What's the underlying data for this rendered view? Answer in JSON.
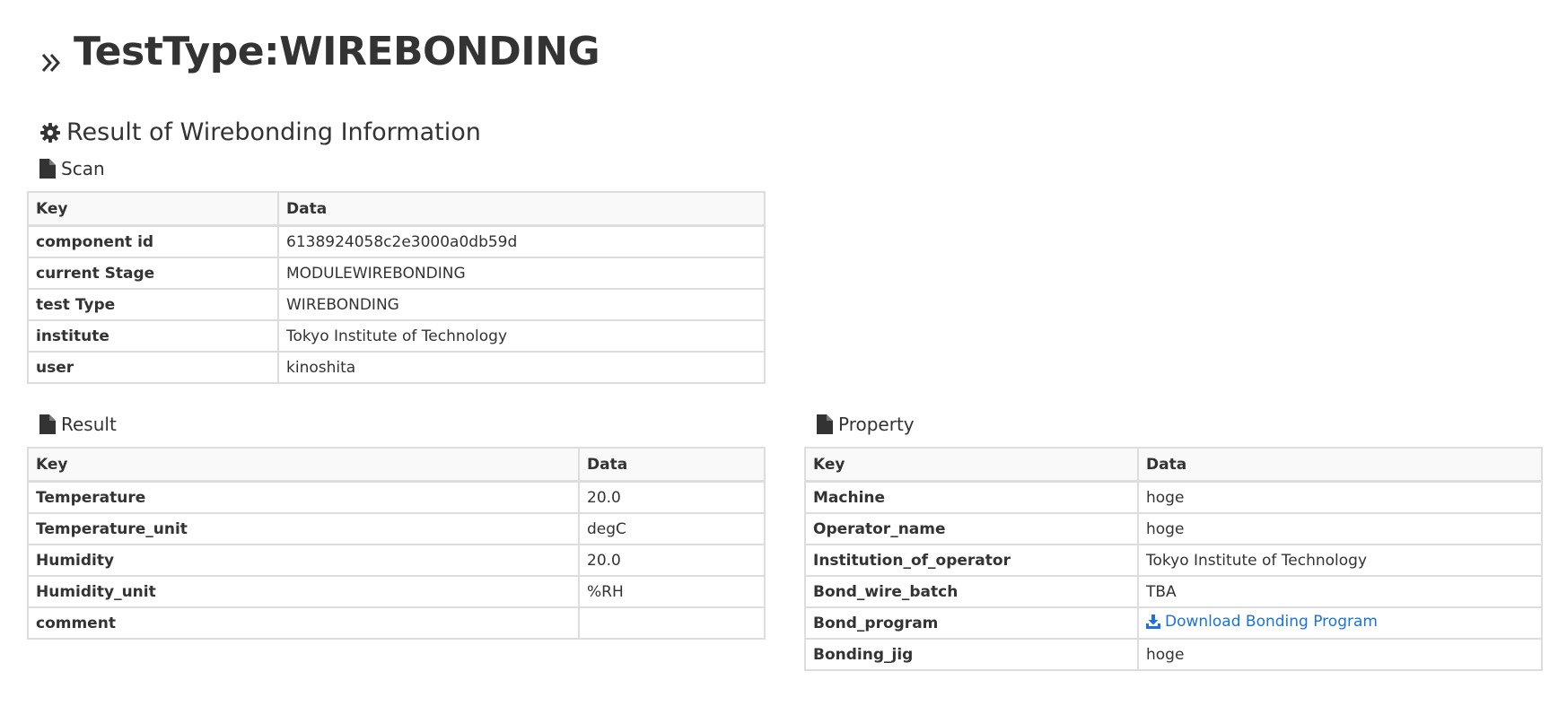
{
  "page_title": "TestType:WIREBONDING",
  "section_title": "Result of Wirebonding Information",
  "scan": {
    "title": "Scan",
    "headers": [
      "Key",
      "Data"
    ],
    "rows": [
      {
        "key": "component id",
        "value": "6138924058c2e3000a0db59d"
      },
      {
        "key": "current Stage",
        "value": "MODULEWIREBONDING"
      },
      {
        "key": "test Type",
        "value": "WIREBONDING"
      },
      {
        "key": "institute",
        "value": "Tokyo Institute of Technology"
      },
      {
        "key": "user",
        "value": "kinoshita"
      }
    ]
  },
  "result": {
    "title": "Result",
    "headers": [
      "Key",
      "Data"
    ],
    "rows": [
      {
        "key": "Temperature",
        "value": "20.0"
      },
      {
        "key": "Temperature_unit",
        "value": "degC"
      },
      {
        "key": "Humidity",
        "value": "20.0"
      },
      {
        "key": "Humidity_unit",
        "value": "%RH"
      },
      {
        "key": "comment",
        "value": ""
      }
    ]
  },
  "property": {
    "title": "Property",
    "headers": [
      "Key",
      "Data"
    ],
    "rows": [
      {
        "key": "Machine",
        "value": "hoge"
      },
      {
        "key": "Operator_name",
        "value": "hoge"
      },
      {
        "key": "Institution_of_operator",
        "value": "Tokyo Institute of Technology"
      },
      {
        "key": "Bond_wire_batch",
        "value": "TBA"
      },
      {
        "key": "Bond_program",
        "value": "Download Bonding Program"
      },
      {
        "key": "Bonding_jig",
        "value": "hoge"
      }
    ]
  },
  "colors": {
    "link": "#1a73d9",
    "border": "#dddddd",
    "header_bg": "#f9f9f9",
    "text": "#333333"
  },
  "icons": {
    "page_title": "double-chevron-right-icon",
    "section_title": "gear-icon",
    "sub_title": "file-icon",
    "download": "download-icon"
  }
}
